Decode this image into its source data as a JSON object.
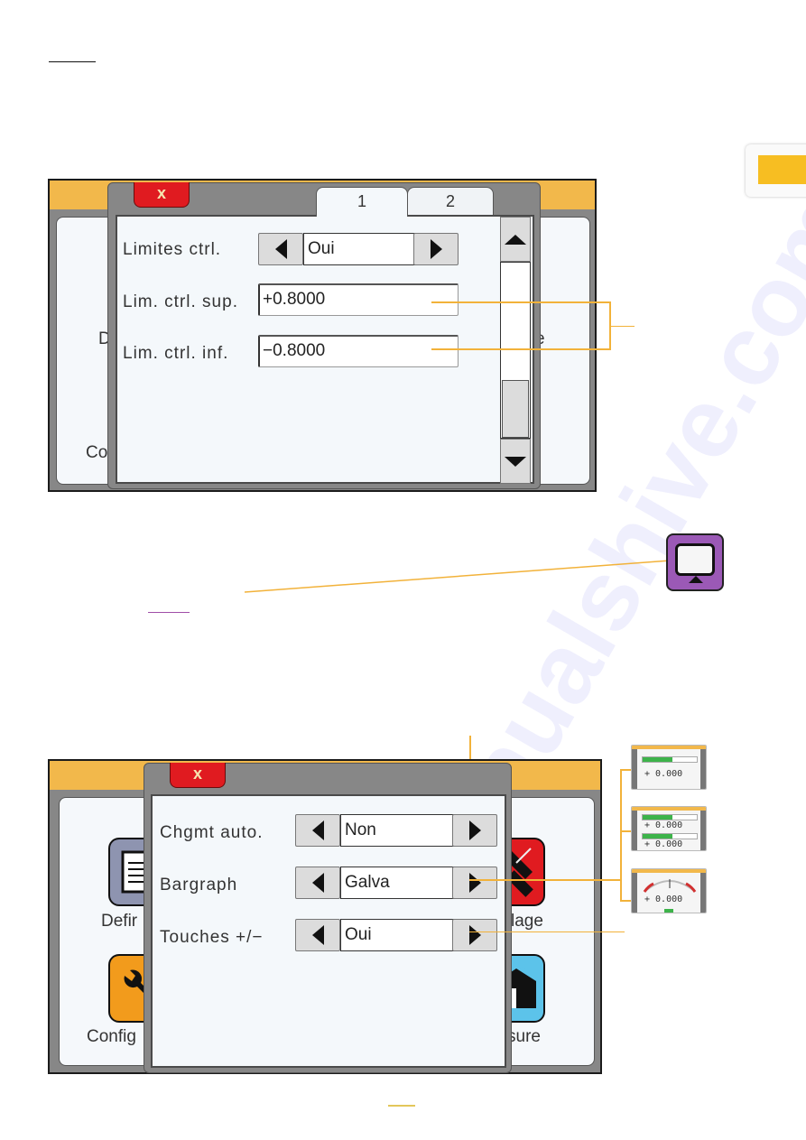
{
  "side_tab": {
    "color": "#f7be22"
  },
  "colors": {
    "callout": "#f2b23a",
    "close": "#e01b20",
    "topbar": "#f2b84b",
    "monitor": "#9b59b6"
  },
  "screen1": {
    "background_labels": {
      "left_mid": "D",
      "left_bottom": "Co",
      "right_mid": "e"
    },
    "dialog": {
      "close_label": "x",
      "tabs": [
        {
          "label": "1",
          "active": true
        },
        {
          "label": "2",
          "active": false
        }
      ],
      "rows": [
        {
          "label": "Limites ctrl.",
          "type": "selector",
          "value": "Oui"
        },
        {
          "label": "Lim. ctrl. sup.",
          "type": "input",
          "value": "+0.8000"
        },
        {
          "label": "Lim. ctrl. inf.",
          "type": "input",
          "value": "−0.8000"
        }
      ],
      "scrollbar": {
        "position": "bottom"
      }
    }
  },
  "monitor_icon": {
    "name": "display-settings"
  },
  "screen2": {
    "background_labels": {
      "defin": "Defir",
      "config": "Config",
      "reglage": "lage",
      "mesure": "sure"
    },
    "dialog": {
      "close_label": "x",
      "rows": [
        {
          "label": "Chgmt auto.",
          "value": "Non"
        },
        {
          "label": "Bargraph",
          "value": "Galva"
        },
        {
          "label": "Touches +/−",
          "value": "Oui"
        }
      ]
    },
    "thumbnails": [
      {
        "type": "single-bargraph",
        "value": "+ 0.000",
        "fill": 0.55
      },
      {
        "type": "double-bargraph",
        "values": [
          "+ 0.000",
          "+ 0.000"
        ],
        "fill": 0.55
      },
      {
        "type": "galvanometer",
        "value": "+ 0.000"
      }
    ]
  }
}
